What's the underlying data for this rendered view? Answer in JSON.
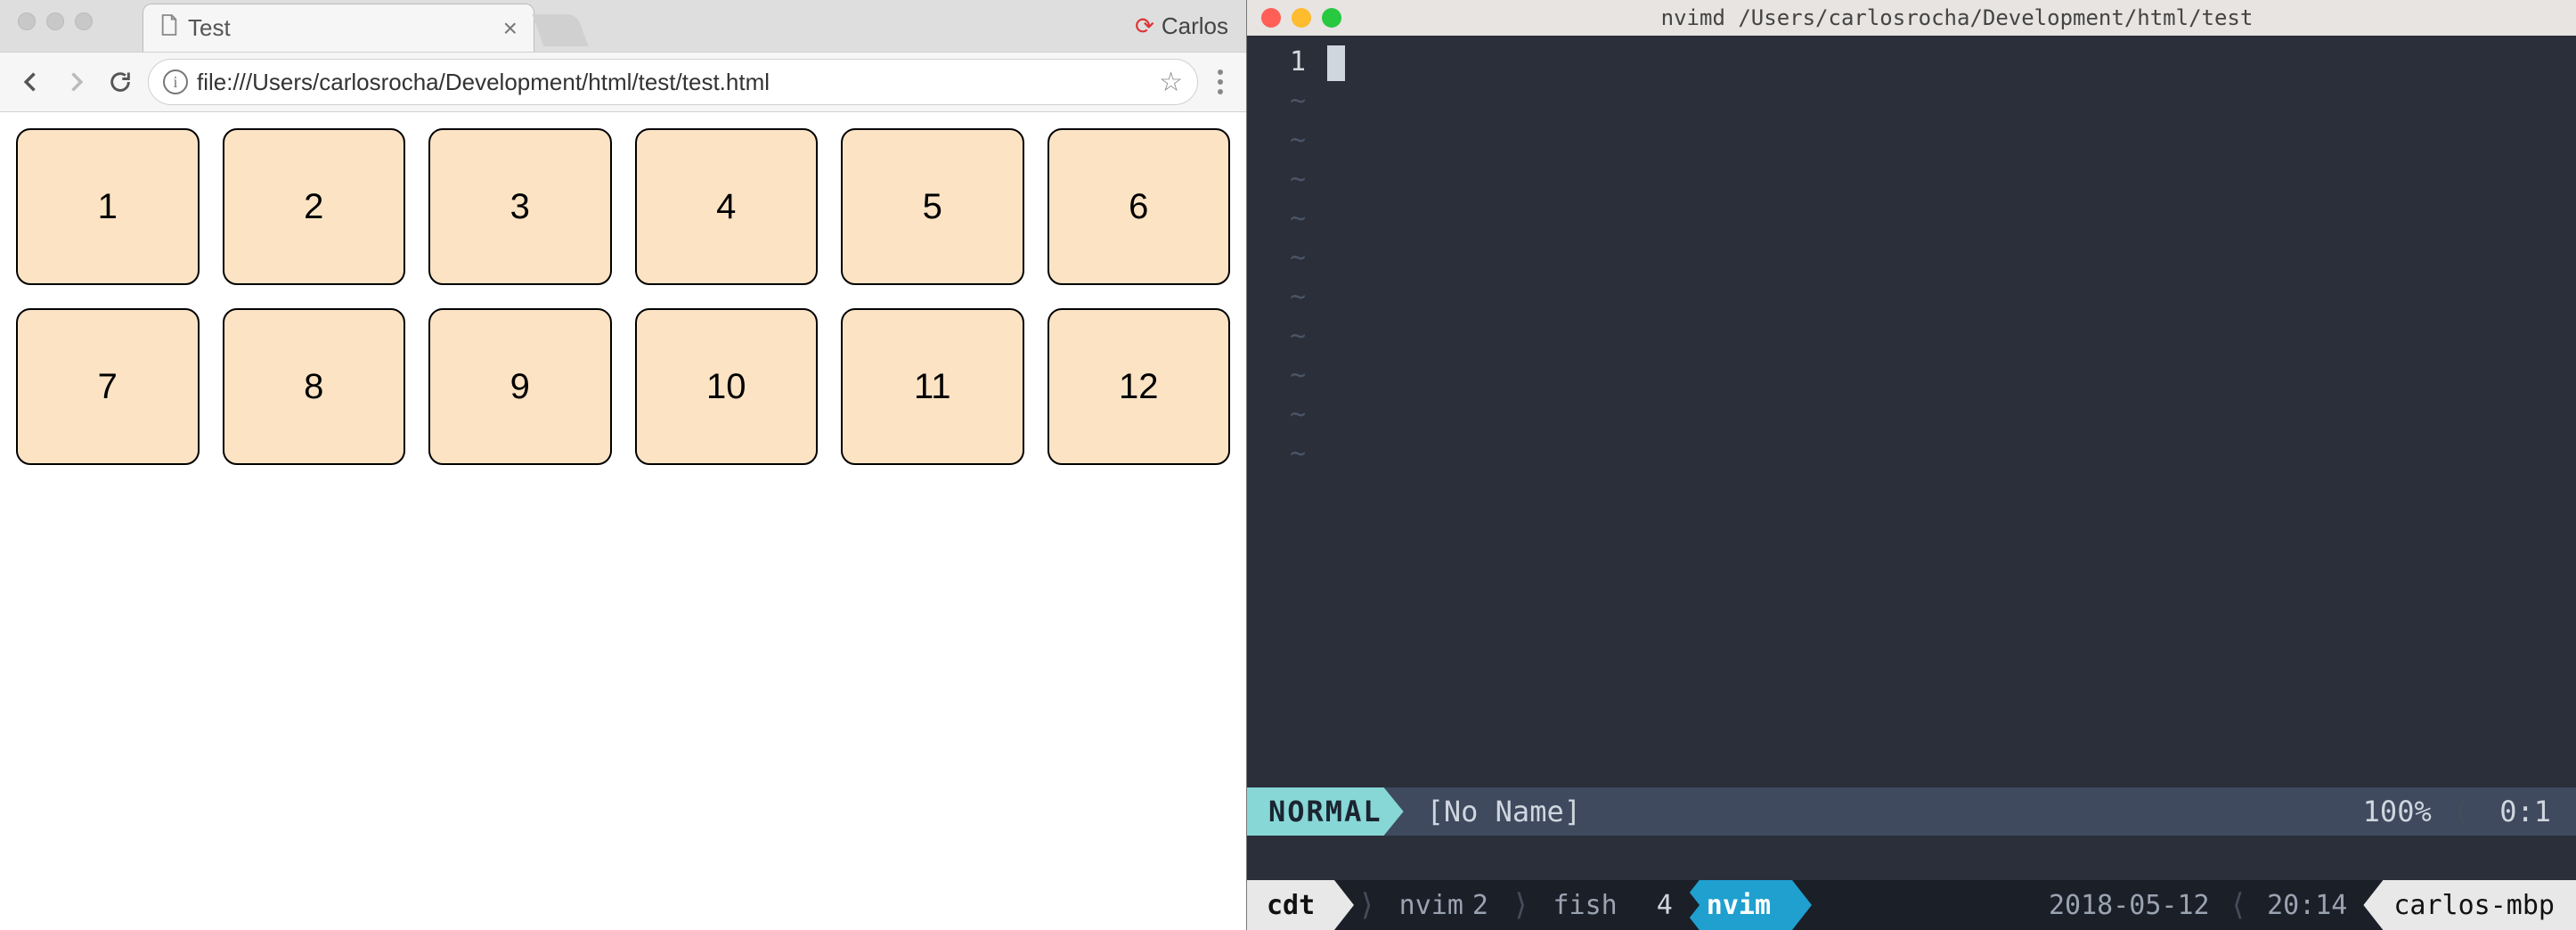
{
  "browser": {
    "tab_title": "Test",
    "profile_name": "Carlos",
    "url": "file:///Users/carlosrocha/Development/html/test/test.html",
    "grid_cells": [
      "1",
      "2",
      "3",
      "4",
      "5",
      "6",
      "7",
      "8",
      "9",
      "10",
      "11",
      "12"
    ]
  },
  "terminal": {
    "title": "nvimd  /Users/carlosrocha/Development/html/test",
    "gutter_first": "1",
    "tilde_rows": 10,
    "status": {
      "mode": "NORMAL",
      "filename": "[No Name]",
      "percent": "100%",
      "position": "0:1"
    },
    "tmux": {
      "session": "cdt",
      "windows": [
        {
          "name": "nvim",
          "index": "2",
          "active": false
        },
        {
          "name": "fish",
          "index": "",
          "active": false
        },
        {
          "name": "nvim",
          "index": "4",
          "active": true,
          "pre_index": "4"
        }
      ],
      "win_inactive_1_name": "nvim",
      "win_inactive_1_idx": "2",
      "win_inactive_2_name": "fish",
      "win_active_pre_idx": "4",
      "win_active_name": "nvim",
      "date": "2018-05-12",
      "time": "20:14",
      "host": "carlos-mbp"
    }
  }
}
